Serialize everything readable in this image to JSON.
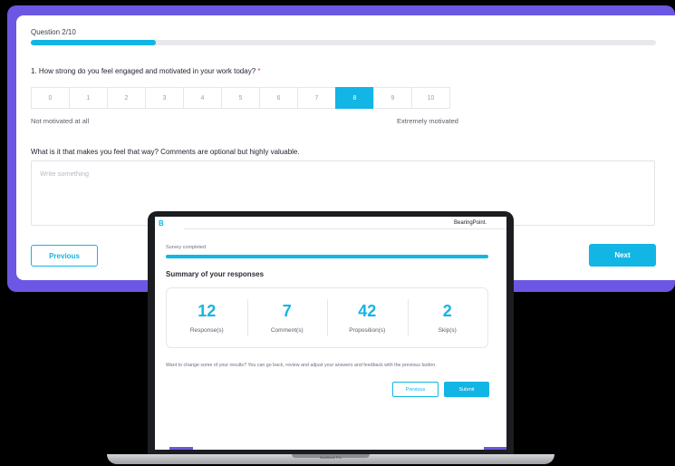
{
  "survey": {
    "question_counter": "Question 2/10",
    "progress": 0.2,
    "question_text": "1. How strong do you feel engaged and motivated in your work today?",
    "required_mark": "*",
    "scale": [
      "0",
      "1",
      "2",
      "3",
      "4",
      "5",
      "6",
      "7",
      "8",
      "9",
      "10"
    ],
    "selected_value": "8",
    "scale_min_label": "Not motivated at all",
    "scale_max_label": "Extremely motivated",
    "comment_question": "What is it that makes you feel that way? Comments are optional but highly valuable.",
    "comment_placeholder": "Write something",
    "previous_label": "Previous",
    "next_label": "Next"
  },
  "laptop": {
    "logo": "B",
    "brand": "BearingPoint.",
    "status": "Survey completed",
    "progress": 1.0,
    "summary_title": "Summary of your responses",
    "stats": [
      {
        "value": "12",
        "label": "Response(s)"
      },
      {
        "value": "7",
        "label": "Comment(s)"
      },
      {
        "value": "42",
        "label": "Proposition(s)"
      },
      {
        "value": "2",
        "label": "Skip(s)"
      }
    ],
    "note": "Want to change some of your results? You can go back, review and adjust your answers and feedback with the previous button.",
    "previous_label": "Previous",
    "submit_label": "Submit",
    "device_label": "MacBook Pro"
  },
  "colors": {
    "accent": "#12b5e3",
    "frame": "#6b57e3"
  }
}
